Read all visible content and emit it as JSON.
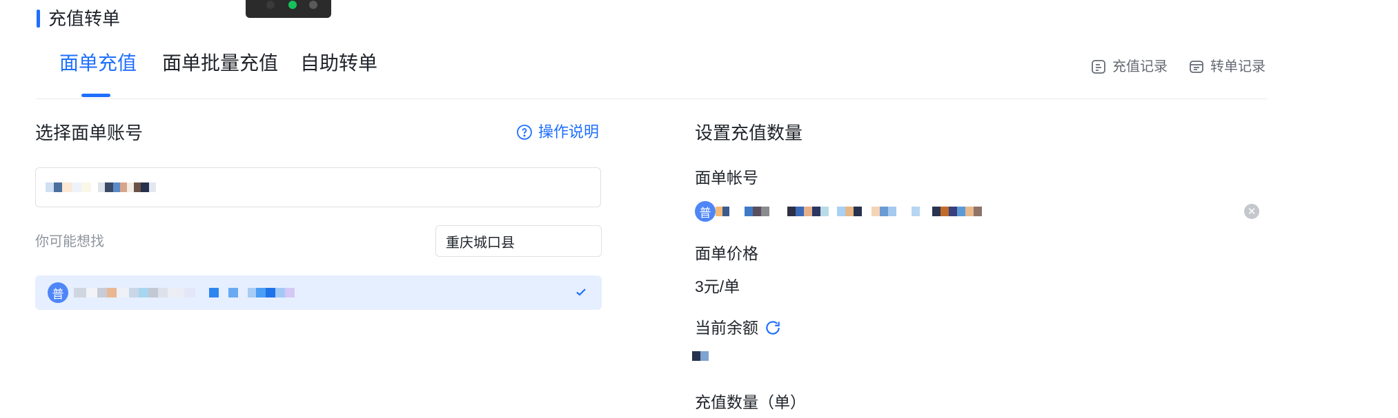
{
  "header": {
    "title": "充值转单"
  },
  "tabs": [
    {
      "label": "面单充值",
      "active": true
    },
    {
      "label": "面单批量充值",
      "active": false
    },
    {
      "label": "自助转单",
      "active": false
    }
  ],
  "records": {
    "recharge_label": "充值记录",
    "transfer_label": "转单记录"
  },
  "left_panel": {
    "title": "选择面单账号",
    "help_label": "操作说明",
    "hint_label": "你可能想找",
    "region_value": "重庆城口县",
    "option_badge": "普"
  },
  "right_panel": {
    "title": "设置充值数量",
    "account_label": "面单帐号",
    "account_badge": "普",
    "price_label": "面单价格",
    "price_value": "3元/单",
    "balance_label": "当前余额",
    "quantity_label": "充值数量（单）"
  },
  "colors": {
    "accent": "#1e6fff",
    "selected_bg": "#e6efff",
    "badge": "#4e86f7"
  }
}
